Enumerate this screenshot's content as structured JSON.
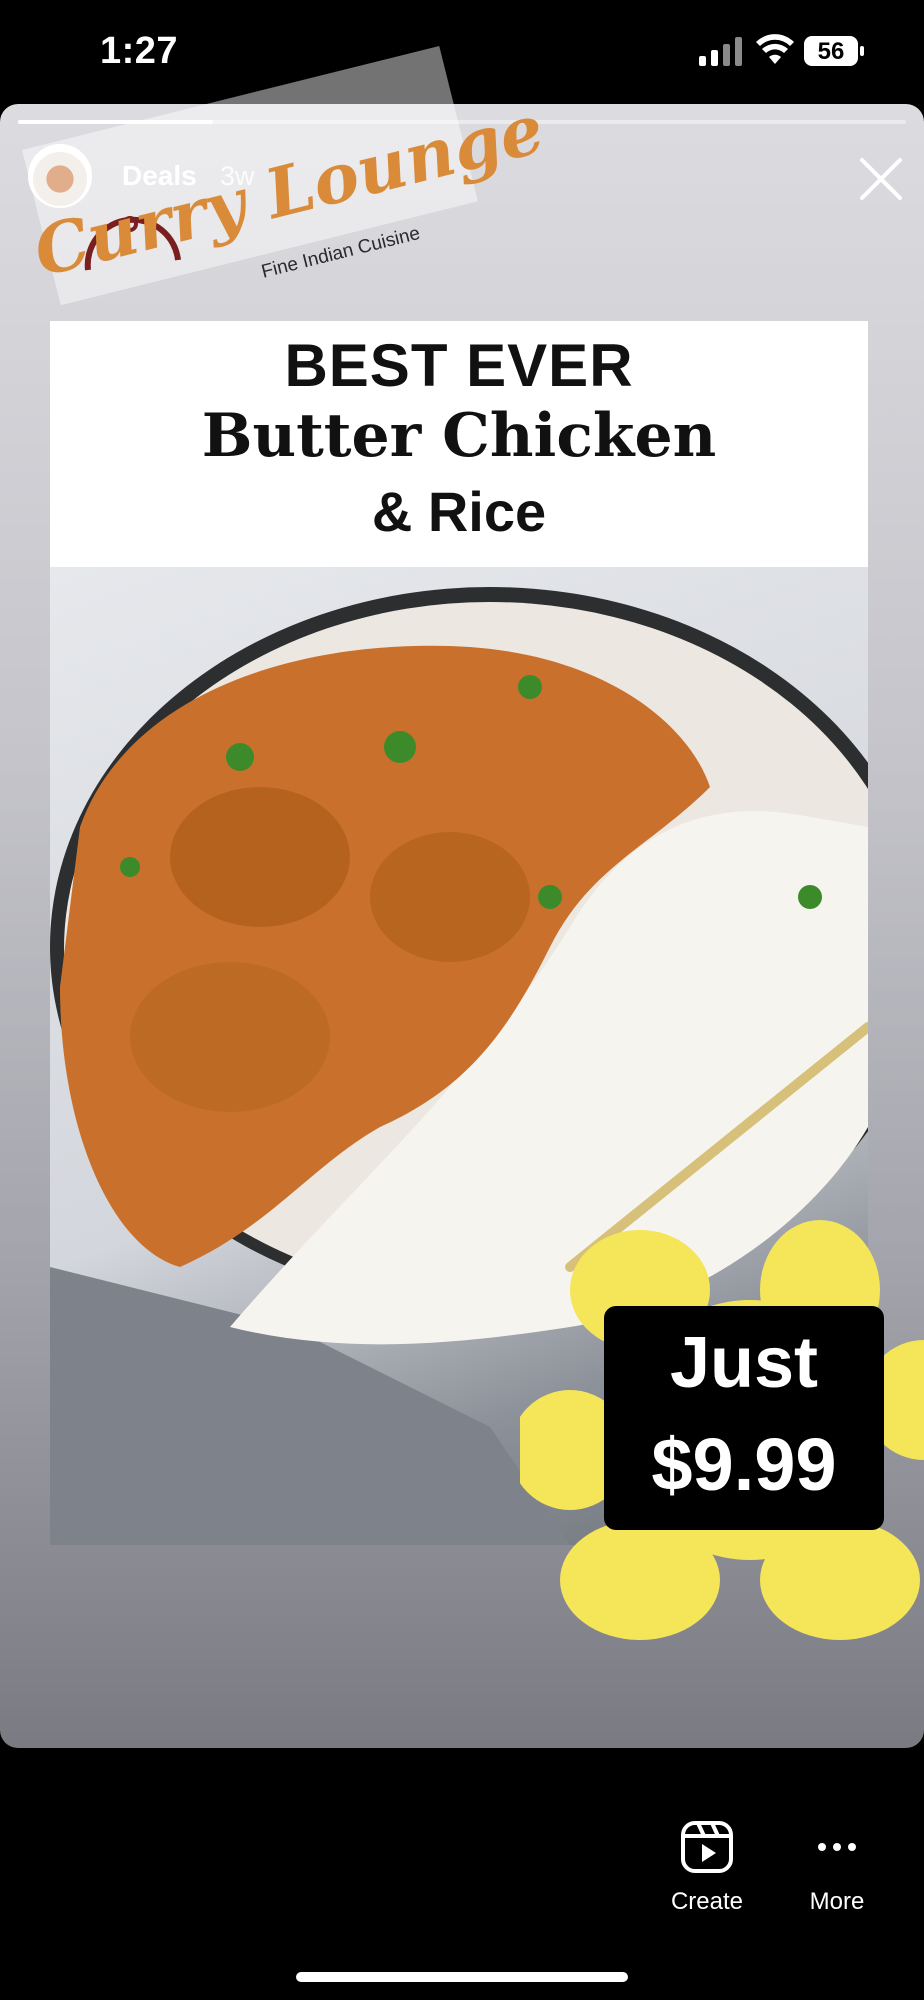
{
  "status_bar": {
    "time": "1:27",
    "battery_level": "56",
    "icons": [
      "signal-icon",
      "wifi-icon",
      "battery-icon"
    ]
  },
  "story": {
    "progress_fraction": 0.22,
    "account_label": "Deals",
    "time_ago": "3w",
    "logo": {
      "name": "Curry Lounge",
      "tagline": "Fine Indian Cuisine"
    },
    "headline": {
      "line1": "BEST EVER",
      "line2": "Butter Chicken",
      "line3": "& Rice"
    },
    "price": {
      "prefix": "Just",
      "amount": "$9.99"
    },
    "colors": {
      "logo_orange": "#d98b3a",
      "flower_yellow": "#f5e559",
      "curry_orange": "#c9712c"
    }
  },
  "bottom_bar": {
    "create_label": "Create",
    "more_label": "More"
  }
}
